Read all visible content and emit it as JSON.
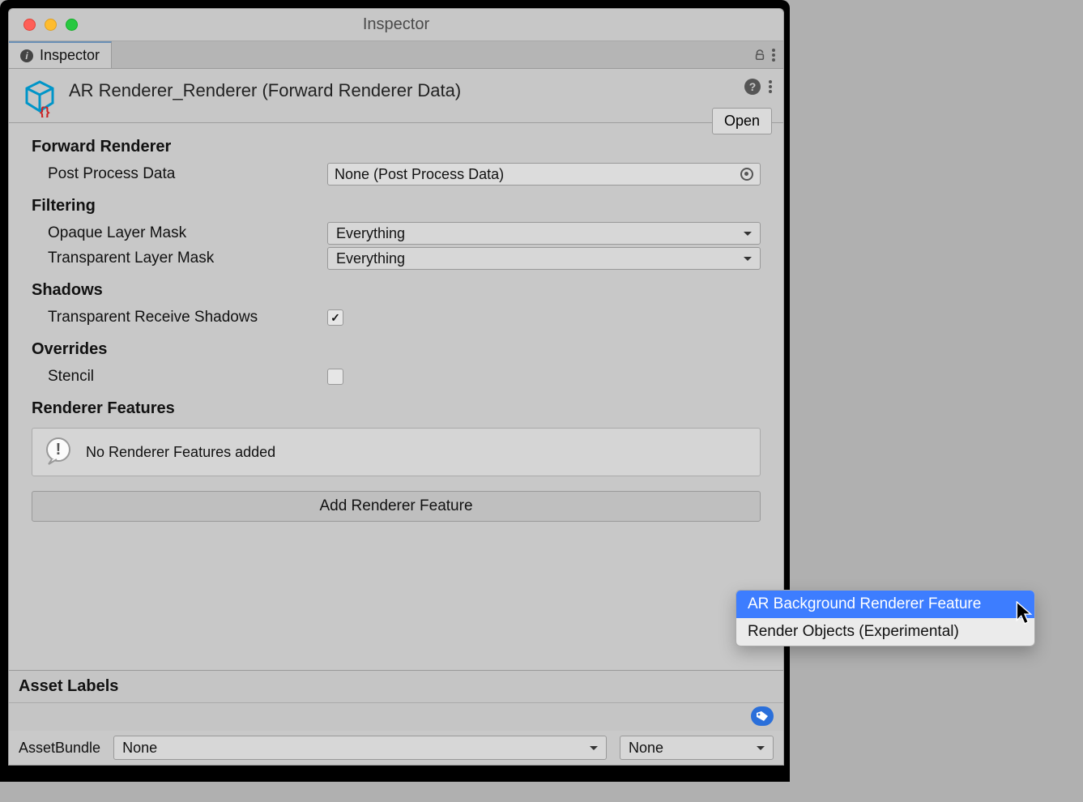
{
  "window": {
    "title": "Inspector"
  },
  "tab": {
    "label": "Inspector"
  },
  "header": {
    "title": "AR Renderer_Renderer (Forward Renderer Data)",
    "open_label": "Open"
  },
  "sections": {
    "forward_renderer": "Forward Renderer",
    "filtering": "Filtering",
    "shadows": "Shadows",
    "overrides": "Overrides",
    "renderer_features": "Renderer Features"
  },
  "fields": {
    "post_process_data": {
      "label": "Post Process Data",
      "value": "None (Post Process Data)"
    },
    "opaque_mask": {
      "label": "Opaque Layer Mask",
      "value": "Everything"
    },
    "transparent_mask": {
      "label": "Transparent Layer Mask",
      "value": "Everything"
    },
    "transparent_shadows": {
      "label": "Transparent Receive Shadows",
      "checked": true
    },
    "stencil": {
      "label": "Stencil",
      "checked": false
    }
  },
  "features": {
    "empty_msg": "No Renderer Features added",
    "add_label": "Add Renderer Feature"
  },
  "asset_labels": {
    "heading": "Asset Labels"
  },
  "asset_bundle": {
    "label": "AssetBundle",
    "value1": "None",
    "value2": "None"
  },
  "popup": {
    "item1": "AR Background Renderer Feature",
    "item2": "Render Objects (Experimental)"
  }
}
